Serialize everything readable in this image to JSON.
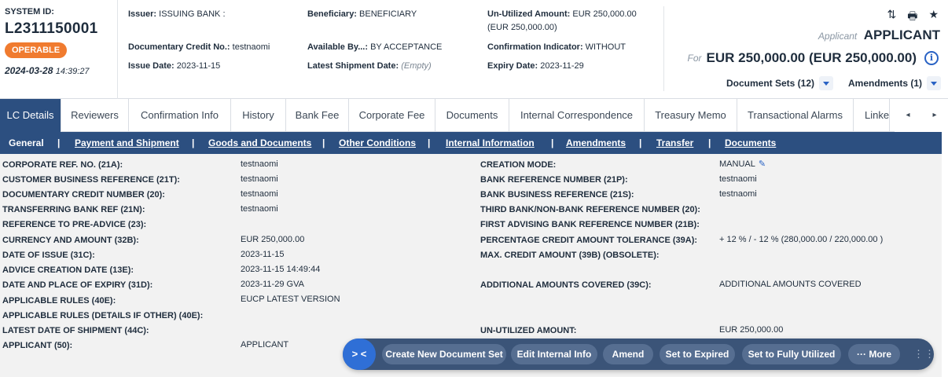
{
  "header": {
    "system_id_label": "SYSTEM ID:",
    "system_id": "L2311150001",
    "status": "OPERABLE",
    "date": "2024-03-28",
    "time": "14:39:27",
    "issuer_label": "Issuer:",
    "issuer": "ISSUING BANK :",
    "beneficiary_label": "Beneficiary:",
    "beneficiary": "BENEFICIARY",
    "unutilized_label": "Un-Utilized Amount:",
    "unutilized": "EUR 250,000.00",
    "unutilized_sub": "(EUR 250,000.00)",
    "dc_no_label": "Documentary Credit No.:",
    "dc_no": "testnaomi",
    "available_label": "Available By...:",
    "available": "BY ACCEPTANCE",
    "confirmation_label": "Confirmation Indicator:",
    "confirmation": "WITHOUT",
    "issue_date_label": "Issue Date:",
    "issue_date": "2023-11-15",
    "shipment_label": "Latest Shipment Date:",
    "shipment": "(Empty)",
    "expiry_label": "Expiry Date:",
    "expiry": "2023-11-29",
    "applicant_label": "Applicant",
    "applicant": "APPLICANT",
    "for_label": "For",
    "for_amount": "EUR 250,000.00 (EUR 250,000.00)",
    "document_sets": "Document Sets (12)",
    "amendments": "Amendments (1)"
  },
  "icons": {
    "sort": "sort-icon",
    "print": "print-icon",
    "favorite": "star-icon",
    "info": "info-icon",
    "edit": "pencil-icon"
  },
  "tabs": [
    "LC Details",
    "Reviewers",
    "Confirmation Info",
    "History",
    "Bank Fee",
    "Corporate Fee",
    "Documents",
    "Internal Correspondence",
    "Treasury Memo",
    "Transactional Alarms",
    "Linke"
  ],
  "subnav": [
    "General",
    "Payment and Shipment",
    "Goods and Documents",
    "Other Conditions",
    "Internal Information",
    "Amendments",
    "Transfer",
    "Documents"
  ],
  "separator": "|",
  "details_left": [
    {
      "label": "CORPORATE REF. NO. (21A):",
      "value": "testnaomi"
    },
    {
      "label": "CUSTOMER BUSINESS REFERENCE (21T):",
      "value": "testnaomi"
    },
    {
      "label": "DOCUMENTARY CREDIT NUMBER (20):",
      "value": "testnaomi"
    },
    {
      "label": "TRANSFERRING BANK REF (21N):",
      "value": "testnaomi"
    },
    {
      "label": "REFERENCE TO PRE-ADVICE (23):",
      "value": ""
    },
    {
      "label": "CURRENCY AND AMOUNT (32B):",
      "value": "EUR  250,000.00"
    },
    {
      "label": "DATE OF ISSUE (31C):",
      "value": "2023-11-15"
    },
    {
      "label": "ADVICE CREATION DATE (13E):",
      "value": "2023-11-15 14:49:44"
    },
    {
      "label": "DATE AND PLACE OF EXPIRY (31D):",
      "value": "2023-11-29  GVA"
    },
    {
      "label": "APPLICABLE RULES (40E):",
      "value": "EUCP LATEST VERSION"
    },
    {
      "label": "APPLICABLE RULES (DETAILS IF OTHER) (40E):",
      "value": ""
    },
    {
      "label": "LATEST DATE OF SHIPMENT (44C):",
      "value": ""
    },
    {
      "label": "APPLICANT (50):",
      "value": "APPLICANT"
    }
  ],
  "details_right": [
    {
      "label": "CREATION MODE:",
      "value": "MANUAL"
    },
    {
      "label": "BANK REFERENCE NUMBER (21P):",
      "value": "testnaomi"
    },
    {
      "label": "BANK BUSINESS REFERENCE (21S):",
      "value": "testnaomi"
    },
    {
      "label": "THIRD BANK/NON-BANK REFERENCE NUMBER (20):",
      "value": ""
    },
    {
      "label": "FIRST ADVISING BANK REFERENCE NUMBER (21B):",
      "value": ""
    },
    {
      "label": "PERCENTAGE CREDIT AMOUNT TOLERANCE (39A):",
      "value": "+ 12 % / - 12 % (280,000.00 / 220,000.00 )"
    },
    {
      "label": "MAX. CREDIT AMOUNT (39B) (OBSOLETE):",
      "value": ""
    },
    {
      "label": "ADDITIONAL AMOUNTS COVERED (39C):",
      "value": "ADDITIONAL AMOUNTS COVERED"
    },
    {
      "label": "UN-UTILIZED AMOUNT:",
      "value": "EUR  250,000.00"
    }
  ],
  "actions": {
    "toggle": "> <",
    "create": "Create New Document Set",
    "edit": "Edit Internal Info",
    "amend": "Amend",
    "expired": "Set to Expired",
    "utilized": "Set to Fully Utilized",
    "more": "··· More"
  },
  "colors": {
    "primary_nav": "#2c4f80",
    "badge": "#f07b2f",
    "action_bar": "#3b5478",
    "accent": "#2962c4"
  }
}
